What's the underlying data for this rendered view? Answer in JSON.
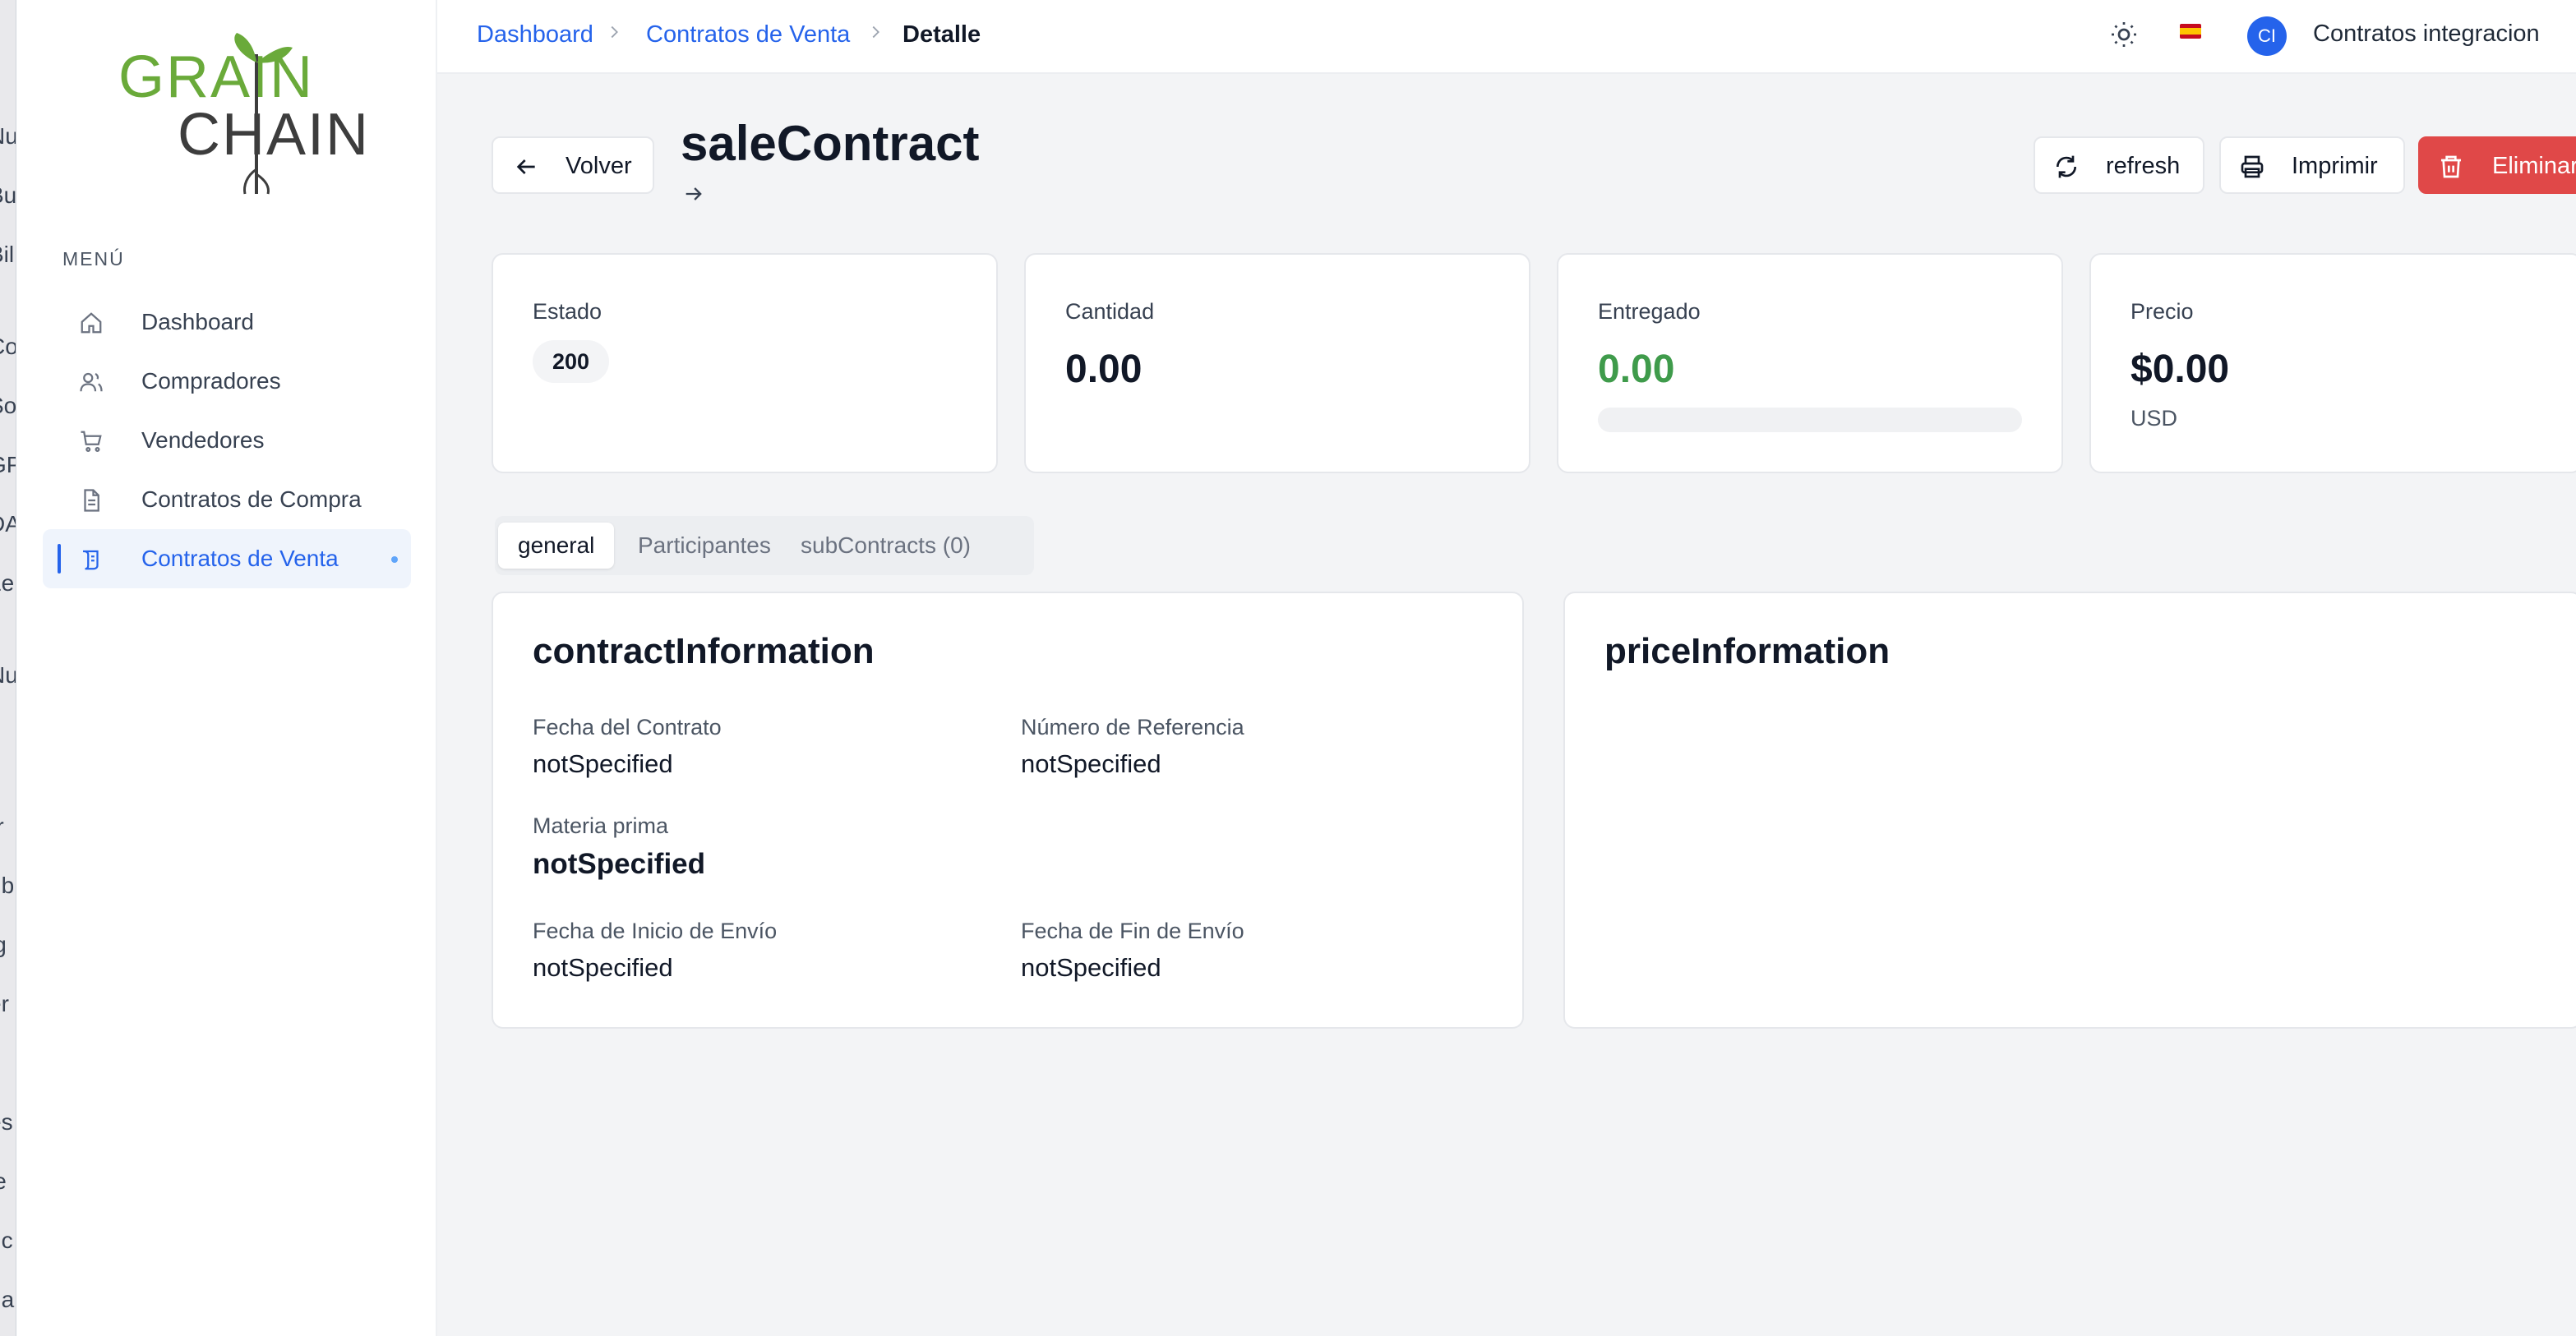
{
  "background_window": {
    "fragments": [
      "Nu",
      "Bu",
      "Bil",
      "Co",
      "So",
      "GP",
      "DA",
      "Le",
      "Nu",
      "s",
      "rr",
      "ub",
      "ig",
      "er",
      "fi",
      "es",
      "le",
      "uc",
      "na"
    ]
  },
  "sidebar": {
    "logo": {
      "line1": "GRAIN",
      "line2": "CHAIN"
    },
    "menu_title": "MENÚ",
    "items": [
      {
        "label": "Dashboard",
        "icon": "home-icon"
      },
      {
        "label": "Compradores",
        "icon": "users-icon"
      },
      {
        "label": "Vendedores",
        "icon": "cart-icon"
      },
      {
        "label": "Contratos de Compra",
        "icon": "document-icon"
      },
      {
        "label": "Contratos de Venta",
        "icon": "scroll-icon",
        "active": true
      }
    ]
  },
  "topbar": {
    "breadcrumb": [
      "Dashboard",
      "Contratos de Venta",
      "Detalle"
    ],
    "theme_icon": "sun-icon",
    "language_icon": "spain-flag-icon",
    "avatar_initials": "CI",
    "user_name": "Contratos integracion"
  },
  "header": {
    "back_label": "Volver",
    "title": "saleContract",
    "refresh_label": "refresh",
    "print_label": "Imprimir",
    "delete_label": "Eliminar"
  },
  "stats": {
    "estado": {
      "label": "Estado",
      "value": "200"
    },
    "cantidad": {
      "label": "Cantidad",
      "value": "0.00"
    },
    "entregado": {
      "label": "Entregado",
      "value": "0.00",
      "progress": 0
    },
    "precio": {
      "label": "Precio",
      "value": "$0.00",
      "currency": "USD"
    }
  },
  "tabs": [
    {
      "label": "general",
      "active": true
    },
    {
      "label": "Participantes"
    },
    {
      "label": "subContracts (0)"
    }
  ],
  "contract_information": {
    "title": "contractInformation",
    "fecha_contrato": {
      "label": "Fecha del Contrato",
      "value": "notSpecified"
    },
    "numero_referencia": {
      "label": "Número de Referencia",
      "value": "notSpecified"
    },
    "materia_prima": {
      "label": "Materia prima",
      "value": "notSpecified"
    },
    "fecha_inicio_envio": {
      "label": "Fecha de Inicio de Envío",
      "value": "notSpecified"
    },
    "fecha_fin_envio": {
      "label": "Fecha de Fin de Envío",
      "value": "notSpecified"
    }
  },
  "price_information": {
    "title": "priceInformation"
  },
  "colors": {
    "accent": "#2563eb",
    "danger": "#e04848",
    "success": "#3f9b4b",
    "logo_green": "#6aaa3a",
    "logo_dark": "#3d3d3d"
  }
}
